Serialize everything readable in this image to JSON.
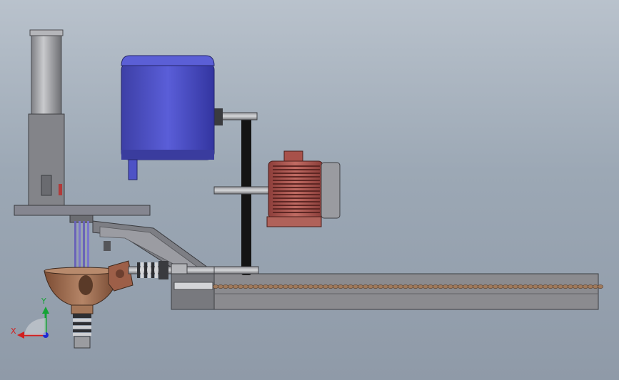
{
  "viewport": {
    "background_top": "#b9c2cc",
    "background_bottom": "#8f9aa8"
  },
  "colors": {
    "motor_blue": "#4b4fc4",
    "motor_red": "#a9544e",
    "frame_gray": "#8a8a8e",
    "dark_gray": "#55565a",
    "belt_black": "#141414",
    "bronze": "#9b6a4d",
    "conveyor_chain": "#a07a5c"
  },
  "triad": {
    "x_label": "X",
    "y_label": "Y",
    "x_color": "#d21f1f",
    "y_color": "#15a335",
    "z_color": "#1f2bd1"
  }
}
